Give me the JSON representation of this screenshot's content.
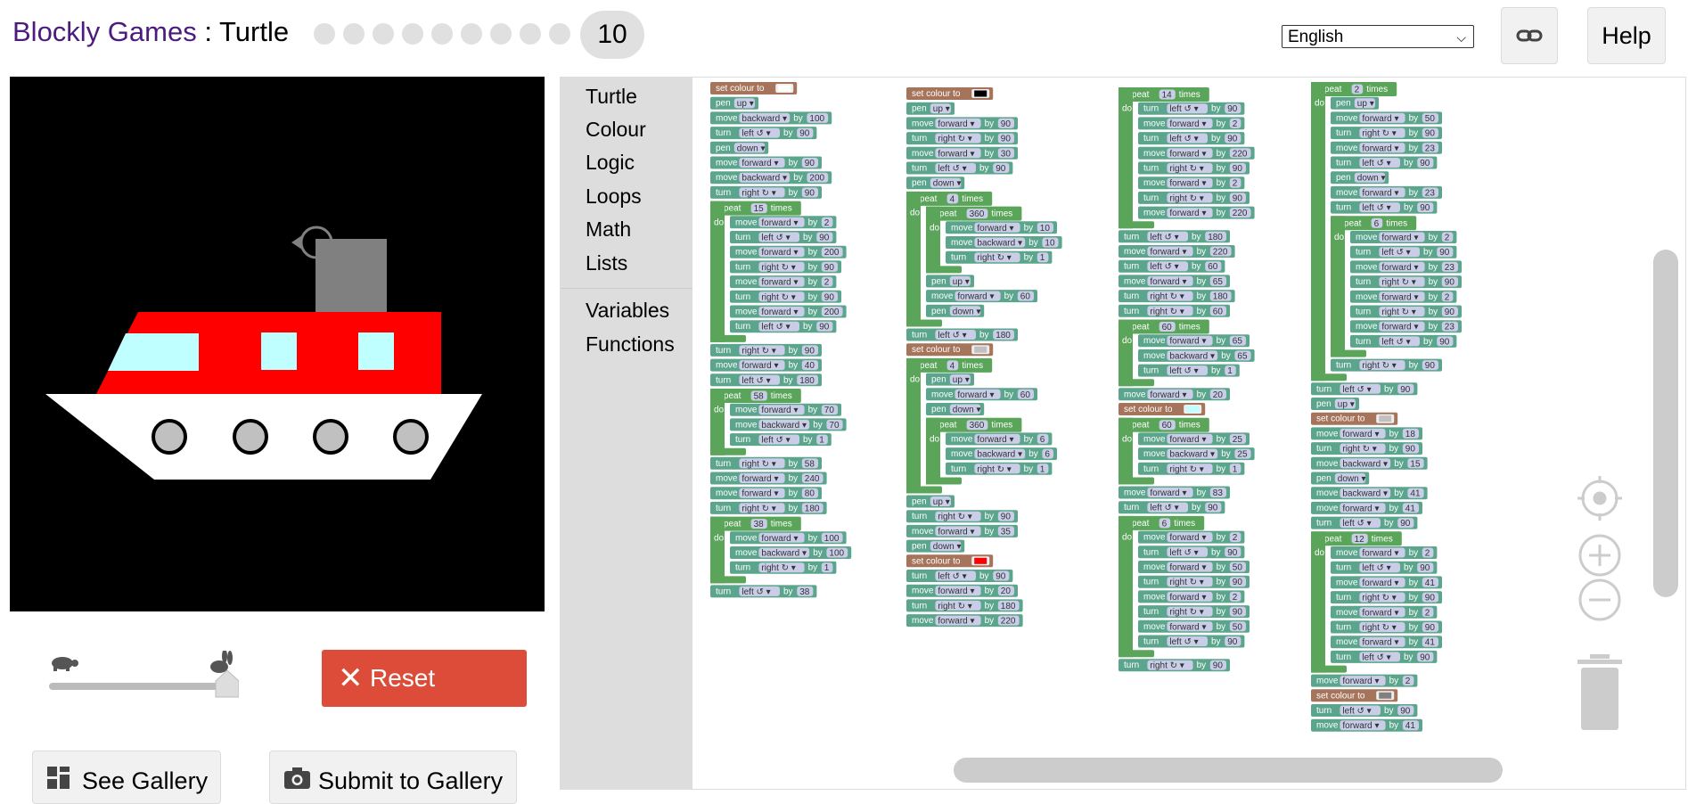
{
  "header": {
    "app_name": "Blockly Games",
    "separator": " : ",
    "game_name": "Turtle",
    "current_level": "10",
    "language": "English",
    "help_label": "Help"
  },
  "toolbox": {
    "categories": [
      "Turtle",
      "Colour",
      "Logic",
      "Loops",
      "Math",
      "Lists",
      "Variables",
      "Functions"
    ]
  },
  "controls": {
    "reset_label": "Reset",
    "gallery_label": "See Gallery",
    "submit_label": "Submit to Gallery"
  },
  "colors": {
    "loop": "#5ba55b",
    "turtle": "#5ba58c",
    "colour": "#a5745b",
    "field": "#c9cde8",
    "reset": "#dd4b39",
    "title": "#4b1c7d",
    "boat_red": "#ff0000",
    "window": "#c0ffff",
    "hull": "#ffffff",
    "porthole": "#c0c0c0",
    "chimney": "#808080"
  },
  "program": [
    {
      "name": "stack-1",
      "blocks": [
        {
          "t": "colour",
          "v": "#ffffff"
        },
        {
          "t": "pen",
          "v": "up"
        },
        {
          "t": "move",
          "d": "backward",
          "n": "100"
        },
        {
          "t": "turn",
          "d": "left ↺",
          "n": "90"
        },
        {
          "t": "pen",
          "v": "down"
        },
        {
          "t": "move",
          "d": "forward",
          "n": "90"
        },
        {
          "t": "move",
          "d": "backward",
          "n": "200"
        },
        {
          "t": "turn",
          "d": "right ↻",
          "n": "90"
        },
        {
          "t": "repeat",
          "n": "15",
          "body": [
            {
              "t": "move",
              "d": "forward",
              "n": "2"
            },
            {
              "t": "turn",
              "d": "left ↺",
              "n": "90"
            },
            {
              "t": "move",
              "d": "forward",
              "n": "200"
            },
            {
              "t": "turn",
              "d": "right ↻",
              "n": "90"
            },
            {
              "t": "move",
              "d": "forward",
              "n": "2"
            },
            {
              "t": "turn",
              "d": "right ↻",
              "n": "90"
            },
            {
              "t": "move",
              "d": "forward",
              "n": "200"
            },
            {
              "t": "turn",
              "d": "left ↺",
              "n": "90"
            }
          ]
        },
        {
          "t": "turn",
          "d": "right ↻",
          "n": "90"
        },
        {
          "t": "move",
          "d": "forward",
          "n": "40"
        },
        {
          "t": "turn",
          "d": "left ↺",
          "n": "180"
        },
        {
          "t": "repeat",
          "n": "58",
          "body": [
            {
              "t": "move",
              "d": "forward",
              "n": "70"
            },
            {
              "t": "move",
              "d": "backward",
              "n": "70"
            },
            {
              "t": "turn",
              "d": "left ↺",
              "n": "1"
            }
          ]
        },
        {
          "t": "turn",
          "d": "right ↻",
          "n": "58"
        },
        {
          "t": "move",
          "d": "forward",
          "n": "240"
        },
        {
          "t": "move",
          "d": "forward",
          "n": "80"
        },
        {
          "t": "turn",
          "d": "right ↻",
          "n": "180"
        },
        {
          "t": "repeat",
          "n": "38",
          "body": [
            {
              "t": "move",
              "d": "forward",
              "n": "100"
            },
            {
              "t": "move",
              "d": "backward",
              "n": "100"
            },
            {
              "t": "turn",
              "d": "right ↻",
              "n": "1"
            }
          ]
        },
        {
          "t": "turn",
          "d": "left ↺",
          "n": "38"
        }
      ]
    },
    {
      "name": "stack-2",
      "blocks": [
        {
          "t": "colour",
          "v": "#000000"
        },
        {
          "t": "pen",
          "v": "up"
        },
        {
          "t": "move",
          "d": "forward",
          "n": "90"
        },
        {
          "t": "turn",
          "d": "right ↻",
          "n": "90"
        },
        {
          "t": "move",
          "d": "forward",
          "n": "30"
        },
        {
          "t": "turn",
          "d": "left ↺",
          "n": "90"
        },
        {
          "t": "pen",
          "v": "down"
        },
        {
          "t": "repeat",
          "n": "4",
          "body": [
            {
              "t": "repeat",
              "n": "360",
              "body": [
                {
                  "t": "move",
                  "d": "forward",
                  "n": "10"
                },
                {
                  "t": "move",
                  "d": "backward",
                  "n": "10"
                },
                {
                  "t": "turn",
                  "d": "right ↻",
                  "n": "1"
                }
              ]
            },
            {
              "t": "pen",
              "v": "up"
            },
            {
              "t": "move",
              "d": "forward",
              "n": "60"
            },
            {
              "t": "pen",
              "v": "down"
            }
          ]
        },
        {
          "t": "turn",
          "d": "left ↺",
          "n": "180"
        },
        {
          "t": "colour",
          "v": "#c0c0c0"
        },
        {
          "t": "repeat",
          "n": "4",
          "body": [
            {
              "t": "pen",
              "v": "up"
            },
            {
              "t": "move",
              "d": "forward",
              "n": "60"
            },
            {
              "t": "pen",
              "v": "down"
            },
            {
              "t": "repeat",
              "n": "360",
              "body": [
                {
                  "t": "move",
                  "d": "forward",
                  "n": "6"
                },
                {
                  "t": "move",
                  "d": "backward",
                  "n": "6"
                },
                {
                  "t": "turn",
                  "d": "right ↻",
                  "n": "1"
                }
              ]
            }
          ]
        },
        {
          "t": "pen",
          "v": "up"
        },
        {
          "t": "turn",
          "d": "right ↻",
          "n": "90"
        },
        {
          "t": "move",
          "d": "forward",
          "n": "35"
        },
        {
          "t": "pen",
          "v": "down"
        },
        {
          "t": "colour",
          "v": "#ff0000"
        },
        {
          "t": "turn",
          "d": "left ↺",
          "n": "90"
        },
        {
          "t": "move",
          "d": "forward",
          "n": "20"
        },
        {
          "t": "turn",
          "d": "right ↻",
          "n": "180"
        },
        {
          "t": "move",
          "d": "forward",
          "n": "220"
        }
      ]
    },
    {
      "name": "stack-3",
      "blocks": [
        {
          "t": "repeat",
          "n": "14",
          "body": [
            {
              "t": "turn",
              "d": "left ↺",
              "n": "90"
            },
            {
              "t": "move",
              "d": "forward",
              "n": "2"
            },
            {
              "t": "turn",
              "d": "left ↺",
              "n": "90"
            },
            {
              "t": "move",
              "d": "forward",
              "n": "220"
            },
            {
              "t": "turn",
              "d": "right ↻",
              "n": "90"
            },
            {
              "t": "move",
              "d": "forward",
              "n": "2"
            },
            {
              "t": "turn",
              "d": "right ↻",
              "n": "90"
            },
            {
              "t": "move",
              "d": "forward",
              "n": "220"
            }
          ]
        },
        {
          "t": "turn",
          "d": "left ↺",
          "n": "180"
        },
        {
          "t": "move",
          "d": "forward",
          "n": "220"
        },
        {
          "t": "turn",
          "d": "left ↺",
          "n": "60"
        },
        {
          "t": "move",
          "d": "forward",
          "n": "65"
        },
        {
          "t": "turn",
          "d": "right ↻",
          "n": "180"
        },
        {
          "t": "turn",
          "d": "right ↻",
          "n": "60"
        },
        {
          "t": "repeat",
          "n": "60",
          "body": [
            {
              "t": "move",
              "d": "forward",
              "n": "65"
            },
            {
              "t": "move",
              "d": "backward",
              "n": "65"
            },
            {
              "t": "turn",
              "d": "left ↺",
              "n": "1"
            }
          ]
        },
        {
          "t": "move",
          "d": "forward",
          "n": "20"
        },
        {
          "t": "colour",
          "v": "#c0ffff"
        },
        {
          "t": "repeat",
          "n": "60",
          "body": [
            {
              "t": "move",
              "d": "forward",
              "n": "25"
            },
            {
              "t": "move",
              "d": "backward",
              "n": "25"
            },
            {
              "t": "turn",
              "d": "right ↻",
              "n": "1"
            }
          ]
        },
        {
          "t": "move",
          "d": "forward",
          "n": "83"
        },
        {
          "t": "turn",
          "d": "left ↺",
          "n": "90"
        },
        {
          "t": "repeat",
          "n": "6",
          "body": [
            {
              "t": "move",
              "d": "forward",
              "n": "2"
            },
            {
              "t": "turn",
              "d": "left ↺",
              "n": "90"
            },
            {
              "t": "move",
              "d": "forward",
              "n": "50"
            },
            {
              "t": "turn",
              "d": "right ↻",
              "n": "90"
            },
            {
              "t": "move",
              "d": "forward",
              "n": "2"
            },
            {
              "t": "turn",
              "d": "right ↻",
              "n": "90"
            },
            {
              "t": "move",
              "d": "forward",
              "n": "50"
            },
            {
              "t": "turn",
              "d": "left ↺",
              "n": "90"
            }
          ]
        },
        {
          "t": "turn",
          "d": "right ↻",
          "n": "90"
        }
      ]
    },
    {
      "name": "stack-4",
      "blocks": [
        {
          "t": "repeat",
          "n": "2",
          "body": [
            {
              "t": "pen",
              "v": "up"
            },
            {
              "t": "move",
              "d": "forward",
              "n": "50"
            },
            {
              "t": "turn",
              "d": "right ↻",
              "n": "90"
            },
            {
              "t": "move",
              "d": "forward",
              "n": "23"
            },
            {
              "t": "turn",
              "d": "left ↺",
              "n": "90"
            },
            {
              "t": "pen",
              "v": "down"
            },
            {
              "t": "move",
              "d": "forward",
              "n": "23"
            },
            {
              "t": "turn",
              "d": "left ↺",
              "n": "90"
            },
            {
              "t": "repeat",
              "n": "6",
              "body": [
                {
                  "t": "move",
                  "d": "forward",
                  "n": "2"
                },
                {
                  "t": "turn",
                  "d": "left ↺",
                  "n": "90"
                },
                {
                  "t": "move",
                  "d": "forward",
                  "n": "23"
                },
                {
                  "t": "turn",
                  "d": "right ↻",
                  "n": "90"
                },
                {
                  "t": "move",
                  "d": "forward",
                  "n": "2"
                },
                {
                  "t": "turn",
                  "d": "right ↻",
                  "n": "90"
                },
                {
                  "t": "move",
                  "d": "forward",
                  "n": "23"
                },
                {
                  "t": "turn",
                  "d": "left ↺",
                  "n": "90"
                }
              ]
            },
            {
              "t": "turn",
              "d": "right ↻",
              "n": "90"
            }
          ]
        },
        {
          "t": "turn",
          "d": "left ↺",
          "n": "90"
        },
        {
          "t": "pen",
          "v": "up"
        },
        {
          "t": "colour",
          "v": "#c0c0c0"
        },
        {
          "t": "move",
          "d": "forward",
          "n": "18"
        },
        {
          "t": "turn",
          "d": "right ↻",
          "n": "90"
        },
        {
          "t": "move",
          "d": "backward",
          "n": "15"
        },
        {
          "t": "pen",
          "v": "down"
        },
        {
          "t": "move",
          "d": "backward",
          "n": "41"
        },
        {
          "t": "move",
          "d": "forward",
          "n": "41"
        },
        {
          "t": "turn",
          "d": "left ↺",
          "n": "90"
        },
        {
          "t": "repeat",
          "n": "12",
          "body": [
            {
              "t": "move",
              "d": "forward",
              "n": "2"
            },
            {
              "t": "turn",
              "d": "left ↺",
              "n": "90"
            },
            {
              "t": "move",
              "d": "forward",
              "n": "41"
            },
            {
              "t": "turn",
              "d": "right ↻",
              "n": "90"
            },
            {
              "t": "move",
              "d": "forward",
              "n": "2"
            },
            {
              "t": "turn",
              "d": "right ↻",
              "n": "90"
            },
            {
              "t": "move",
              "d": "forward",
              "n": "41"
            },
            {
              "t": "turn",
              "d": "left ↺",
              "n": "90"
            }
          ]
        },
        {
          "t": "move",
          "d": "forward",
          "n": "2"
        },
        {
          "t": "colour",
          "v": "#808080"
        },
        {
          "t": "turn",
          "d": "left ↺",
          "n": "90"
        },
        {
          "t": "move",
          "d": "forward",
          "n": "41"
        }
      ]
    }
  ]
}
